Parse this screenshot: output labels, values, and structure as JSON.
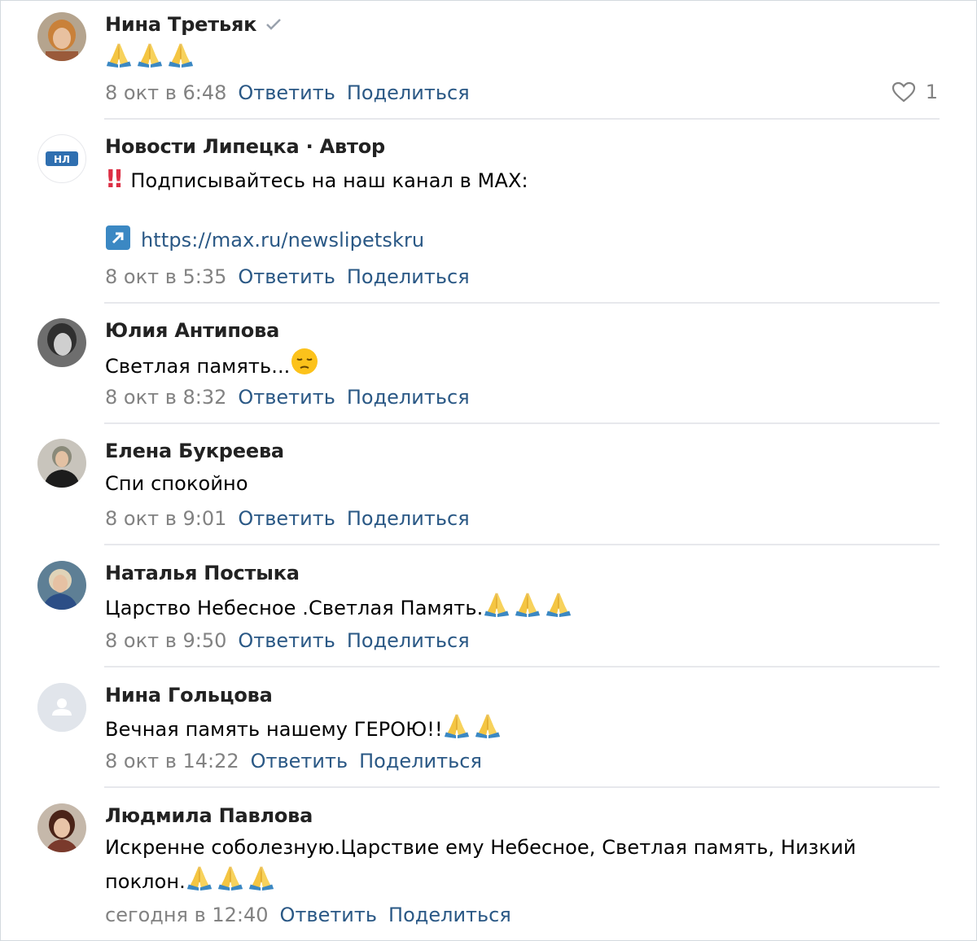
{
  "colors": {
    "link": "#2a5885",
    "meta": "#828282",
    "divider": "#e7e8ec"
  },
  "actions": {
    "reply": "Ответить",
    "share": "Поделиться"
  },
  "comments": [
    {
      "author": "Нина Третьяк",
      "verified_icon": "checkmark-icon",
      "text": "",
      "emojis": [
        "folded-hands-icon",
        "folded-hands-icon",
        "folded-hands-icon"
      ],
      "date": "8 окт в 6:48",
      "likes": "1",
      "like_icon": "heart-icon"
    },
    {
      "author": "Новости Липецка · Автор",
      "avatar_text": "НЛ",
      "text": "Подписывайтесь на наш канал в MAX:",
      "lead_icon": "double-exclamation-icon",
      "link_icon": "arrow-up-right-icon",
      "link": "https://max.ru/newslipetskru",
      "date": "8 окт в 5:35"
    },
    {
      "author": "Юлия Антипова",
      "text": "Светлая память...",
      "emojis": [
        "pensive-face-icon"
      ],
      "date": "8 окт в 8:32"
    },
    {
      "author": "Елена Букреева",
      "text": "Спи спокойно",
      "date": "8 окт в 9:01"
    },
    {
      "author": "Наталья Постыка",
      "text": "Царство Небесное .Светлая Память.",
      "emojis": [
        "folded-hands-icon",
        "folded-hands-icon",
        "folded-hands-icon"
      ],
      "date": "8 окт в 9:50"
    },
    {
      "author": "Нина Гольцова",
      "text": "Вечная память нашему ГЕРОЮ!!",
      "emojis": [
        "folded-hands-icon",
        "folded-hands-icon"
      ],
      "date": "8 окт в 14:22"
    },
    {
      "author": "Людмила Павлова",
      "text_line1": "Искренне соболезную.Царствие ему Небесное, Светлая память, Низкий",
      "text_line2": "поклон.",
      "emojis": [
        "folded-hands-icon",
        "folded-hands-icon",
        "folded-hands-icon"
      ],
      "date": "сегодня в 12:40"
    }
  ]
}
